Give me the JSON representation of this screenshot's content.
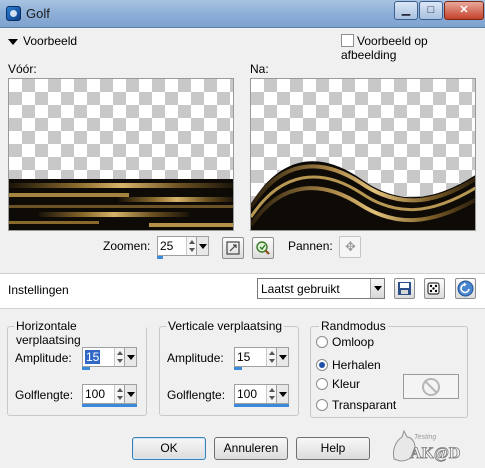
{
  "window": {
    "title": "Golf"
  },
  "preview": {
    "header": "Voorbeeld",
    "show_on_image_label": "Voorbeeld op afbeelding",
    "before_label": "Vóór:",
    "after_label": "Na:"
  },
  "zoom": {
    "label": "Zoomen:",
    "value": "25",
    "fill": 0.25,
    "pan_label": "Pannen:"
  },
  "settings": {
    "label": "Instellingen",
    "preset_value": "Laatst gebruikt"
  },
  "horizontal": {
    "title": "Horizontale verplaatsing",
    "amplitude_label": "Amplitude:",
    "amplitude_value": "15",
    "amplitude_fill": 0.15,
    "wavelength_label": "Golflengte:",
    "wavelength_value": "100",
    "wavelength_fill": 1.0
  },
  "vertical": {
    "title": "Verticale verplaatsing",
    "amplitude_label": "Amplitude:",
    "amplitude_value": "15",
    "amplitude_fill": 0.15,
    "wavelength_label": "Golflengte:",
    "wavelength_value": "100",
    "wavelength_fill": 1.0
  },
  "edge_mode": {
    "title": "Randmodus",
    "options": [
      "Omloop",
      "Herhalen",
      "Kleur",
      "Transparant"
    ],
    "selected": "Herhalen"
  },
  "buttons": {
    "ok": "OK",
    "cancel": "Annuleren",
    "help": "Help"
  },
  "watermark": {
    "small": "Testing",
    "main": "AK@D"
  },
  "icons": [
    "app-icon",
    "minimize-icon",
    "maximize-icon",
    "close-icon",
    "fit-zoom-icon",
    "proof-icon",
    "pan-icon",
    "save-preset-icon",
    "randomize-icon",
    "reset-icon",
    "no-color-icon"
  ]
}
